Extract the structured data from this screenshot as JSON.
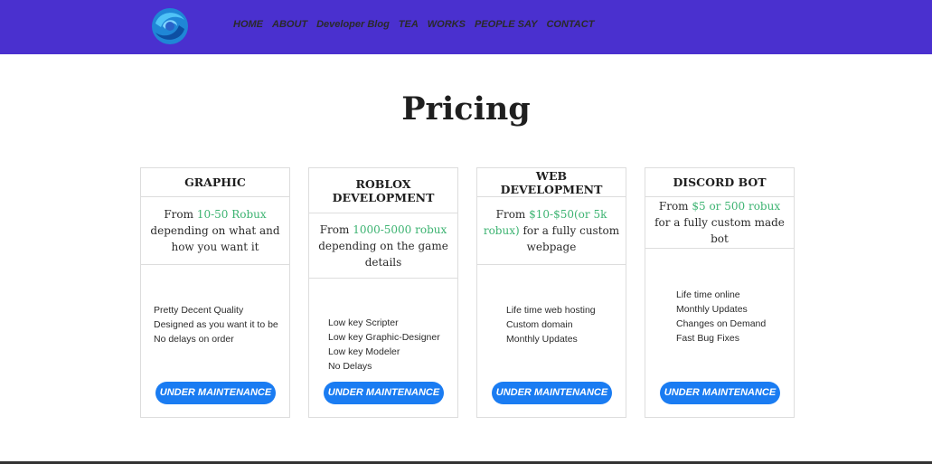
{
  "nav": {
    "logo": "swirl-logo",
    "links": [
      "HOME",
      "ABOUT",
      "Developer Blog",
      "TEA",
      "WORKS",
      "PEOPLE SAY",
      "CONTACT"
    ]
  },
  "pricing": {
    "title": "Pricing",
    "cards": [
      {
        "name": "GRAPHIC",
        "price_prefix": "From ",
        "price_highlight": "10-50 Robux",
        "price_suffix": " depending on what and how you want it",
        "features": [
          "Pretty Decent Quality",
          "Designed as you want it to be",
          "No delays on order"
        ],
        "button": "UNDER MAINTENANCE"
      },
      {
        "name": "ROBLOX DEVELOPMENT",
        "price_prefix": "From ",
        "price_highlight": "1000-5000 robux",
        "price_suffix": " depending on the game details",
        "features": [
          "Low key Scripter",
          "Low key Graphic-Designer",
          "Low key Modeler",
          "No Delays"
        ],
        "button": "UNDER MAINTENANCE"
      },
      {
        "name": "WEB DEVELOPMENT",
        "price_prefix": "From ",
        "price_highlight": "$10-$50(or 5k robux)",
        "price_suffix": " for a fully custom webpage",
        "features": [
          "Life time web hosting",
          "Custom domain",
          "Monthly Updates"
        ],
        "button": "UNDER MAINTENANCE"
      },
      {
        "name": "DISCORD BOT",
        "price_prefix": "From ",
        "price_highlight": "$5 or 500 robux",
        "price_suffix": " for a fully custom made bot",
        "features": [
          "Life time online",
          "Monthly Updates",
          "Changes on Demand",
          "Fast Bug Fixes"
        ],
        "button": "UNDER MAINTENANCE"
      }
    ]
  },
  "colors": {
    "navbar": "#4a30cf",
    "accent_text": "#3cb371",
    "button": "#1a7cf2"
  }
}
